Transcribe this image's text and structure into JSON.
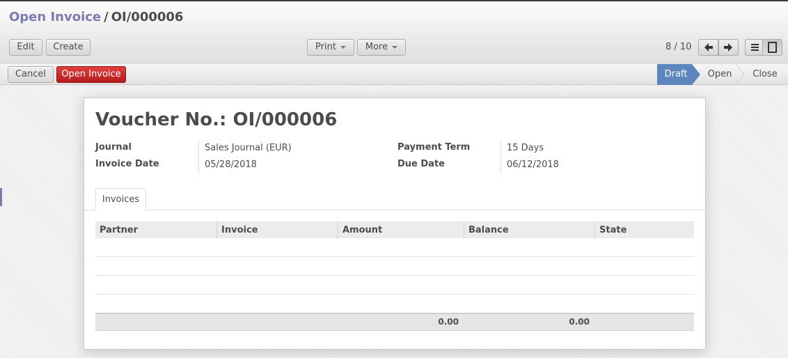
{
  "breadcrumb": {
    "parent": "Open Invoice",
    "separator": "/",
    "current": "OI/000006"
  },
  "toolbar": {
    "edit_label": "Edit",
    "create_label": "Create",
    "print_label": "Print",
    "more_label": "More",
    "pager_value": "8 / 10",
    "icons": [
      "arrow-left-icon",
      "arrow-right-icon",
      "list-view-icon",
      "form-view-icon"
    ]
  },
  "statusbar": {
    "cancel_label": "Cancel",
    "open_invoice_label": "Open Invoice",
    "stages": [
      "Draft",
      "Open",
      "Close"
    ],
    "active_stage": "Draft"
  },
  "form": {
    "title_prefix": "Voucher No.:",
    "title_value": "OI/000006",
    "journal_label": "Journal",
    "journal_value": "Sales Journal (EUR)",
    "invoice_date_label": "Invoice Date",
    "invoice_date_value": "05/28/2018",
    "payment_term_label": "Payment Term",
    "payment_term_value": "15 Days",
    "due_date_label": "Due Date",
    "due_date_value": "06/12/2018"
  },
  "tabs": {
    "invoices_label": "Invoices"
  },
  "table": {
    "columns": [
      "Partner",
      "Invoice",
      "Amount",
      "Balance",
      "State"
    ],
    "rows": [],
    "totals": {
      "amount": "0.00",
      "balance": "0.00"
    }
  },
  "colors": {
    "accent": "#7c7bad",
    "primary_button": "#c9252b",
    "active_stage": "#5c86bd"
  }
}
